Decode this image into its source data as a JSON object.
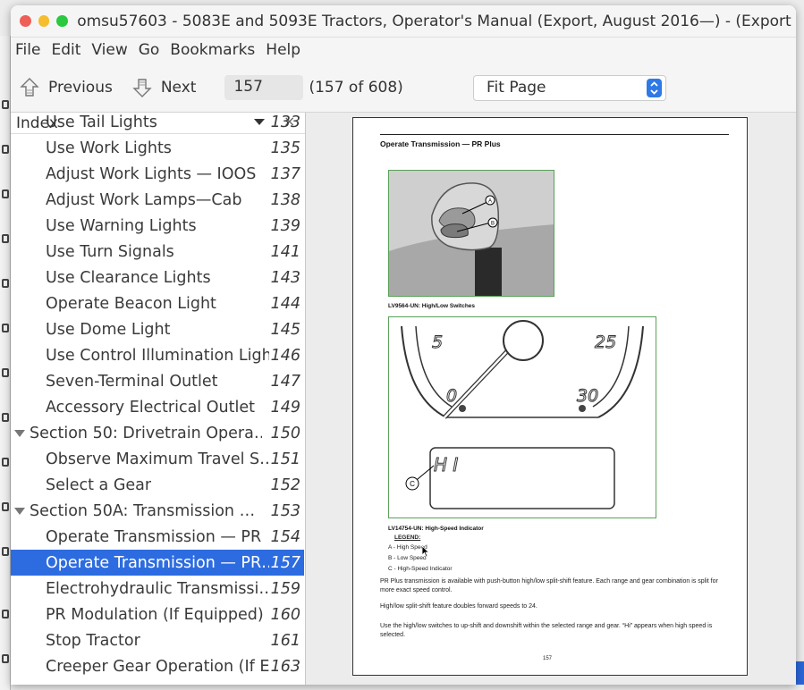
{
  "window": {
    "title": "omsu57603 - 5083E and 5093E Tractors, Operator's Manual (Export, August 2016—) - (Export …"
  },
  "menu": [
    "File",
    "Edit",
    "View",
    "Go",
    "Bookmarks",
    "Help"
  ],
  "toolbar": {
    "previous_label": "Previous",
    "next_label": "Next",
    "page_input": "157",
    "page_count": "(157 of 608)",
    "zoom_value": "Fit Page"
  },
  "sidebar": {
    "title": "Index",
    "close_glyph": "×",
    "items": [
      {
        "label": "Use Tail Lights",
        "page": "133",
        "level": 1
      },
      {
        "label": "Use Work Lights",
        "page": "135",
        "level": 1
      },
      {
        "label": "Adjust Work Lights — IOOS",
        "page": "137",
        "level": 1
      },
      {
        "label": "Adjust Work Lamps—Cab",
        "page": "138",
        "level": 1
      },
      {
        "label": "Use Warning Lights",
        "page": "139",
        "level": 1
      },
      {
        "label": "Use Turn Signals",
        "page": "141",
        "level": 1
      },
      {
        "label": "Use Clearance Lights",
        "page": "143",
        "level": 1
      },
      {
        "label": "Operate Beacon Light",
        "page": "144",
        "level": 1
      },
      {
        "label": "Use Dome Light",
        "page": "145",
        "level": 1
      },
      {
        "label": "Use Control Illumination Light",
        "page": "146",
        "level": 1
      },
      {
        "label": "Seven-Terminal Outlet",
        "page": "147",
        "level": 1
      },
      {
        "label": "Accessory Electrical Outlet",
        "page": "149",
        "level": 1
      },
      {
        "label": "Section 50: Drivetrain Opera…",
        "page": "150",
        "level": 0
      },
      {
        "label": "Observe Maximum Travel S…",
        "page": "151",
        "level": 1
      },
      {
        "label": "Select a Gear",
        "page": "152",
        "level": 1
      },
      {
        "label": "Section 50A: Transmission …",
        "page": "153",
        "level": 0
      },
      {
        "label": "Operate Transmission — PR",
        "page": "154",
        "level": 1
      },
      {
        "label": "Operate Transmission — PR…",
        "page": "157",
        "level": 1,
        "selected": true
      },
      {
        "label": "Electrohydraulic Transmissi…",
        "page": "159",
        "level": 1
      },
      {
        "label": "PR Modulation (If Equipped)",
        "page": "160",
        "level": 1
      },
      {
        "label": "Stop Tractor",
        "page": "161",
        "level": 1
      },
      {
        "label": "Creeper Gear Operation (If E…",
        "page": "163",
        "level": 1
      }
    ]
  },
  "document": {
    "heading": "Operate Transmission — PR Plus",
    "figure1_caption": "LV9564-UN: High/Low Switches",
    "figure2_caption": "LV14754-UN: High-Speed Indicator",
    "callouts": {
      "a": "A",
      "b": "B",
      "c": "C"
    },
    "gauge_labels": [
      "5",
      "25",
      "0",
      "30"
    ],
    "display_text": "H I",
    "legend_title": "LEGEND:",
    "legend": [
      "A - High Speed",
      "B - Low Speed",
      "C - High-Speed Indicator"
    ],
    "paragraphs": [
      "PR Plus transmission is available with push-button high/low split-shift feature. Each range and gear combination is split for more exact speed control.",
      "High/low split-shift feature doubles forward speeds to 24.",
      "Use the high/low switches to up-shift and downshift within the selected range and gear. “Hi” appears when high speed is selected."
    ],
    "page_footer": "157"
  },
  "colors": {
    "selection": "#2d6ce0",
    "figure_border": "#5aa05a",
    "zoom_button": "#2f79e7"
  }
}
